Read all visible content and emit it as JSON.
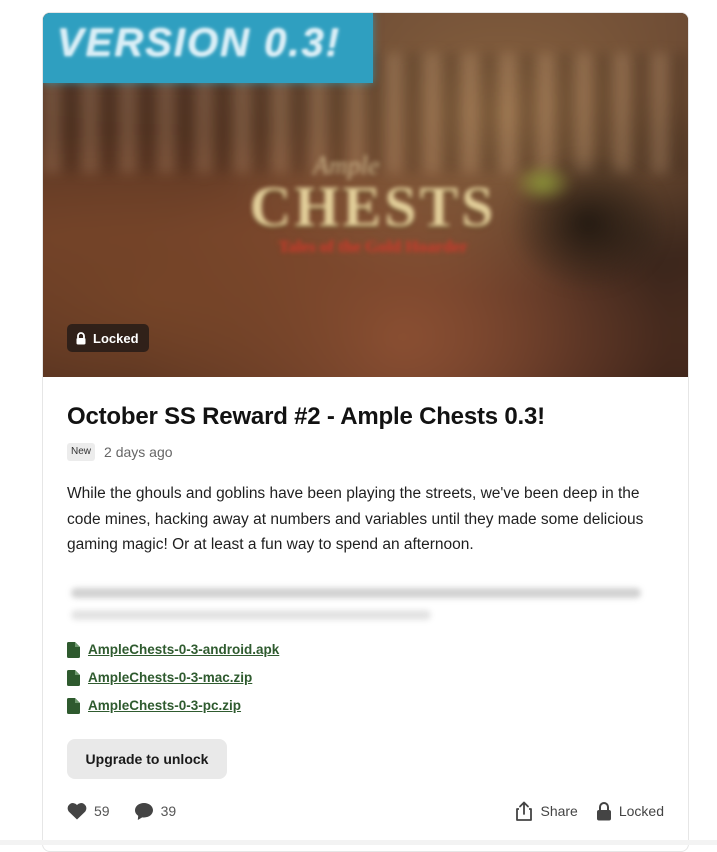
{
  "hero": {
    "banner_text": "VERSION 0.3!",
    "logo_small": "Ample",
    "logo_big": "CHESTS",
    "logo_sub": "Tales of the Gold Hoarder",
    "locked_chip": "Locked"
  },
  "post": {
    "title": "October SS Reward #2 - Ample Chests 0.3!",
    "badge": "New",
    "time": "2 days ago",
    "body": "While the ghouls and goblins have been playing the streets, we've been deep in the code mines, hacking away at numbers and variables until they made some delicious gaming magic! Or at least a fun way to spend an afternoon.",
    "files": [
      {
        "name": "AmpleChests-0-3-android.apk"
      },
      {
        "name": "AmpleChests-0-3-mac.zip"
      },
      {
        "name": "AmpleChests-0-3-pc.zip"
      }
    ],
    "upgrade_label": "Upgrade to unlock"
  },
  "footer": {
    "likes": "59",
    "comments": "39",
    "share_label": "Share",
    "locked_label": "Locked"
  },
  "colors": {
    "banner": "#2f9fc0",
    "file_icon": "#2e5a2e",
    "link": "#2f5b2f"
  }
}
